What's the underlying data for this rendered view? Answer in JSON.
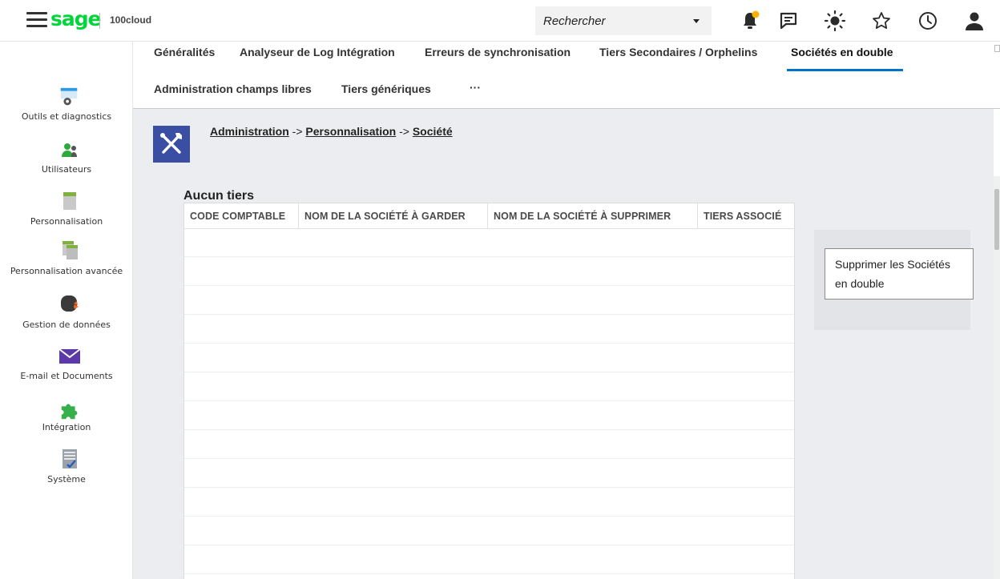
{
  "topbar": {
    "logo": "sage",
    "product": "100cloud",
    "search_placeholder": "Rechercher",
    "notification_dot_color": "#ffb100"
  },
  "sidebar": {
    "items": [
      {
        "label": "Outils et diagnostics",
        "icon": "tools-diagnostics-icon"
      },
      {
        "label": "Utilisateurs",
        "icon": "users-icon"
      },
      {
        "label": "Personnalisation",
        "icon": "customization-icon"
      },
      {
        "label": "Personnalisation avancée",
        "icon": "advanced-customization-icon"
      },
      {
        "label": "Gestion de données",
        "icon": "database-icon"
      },
      {
        "label": "E-mail et Documents",
        "icon": "mail-icon"
      },
      {
        "label": "Intégration",
        "icon": "puzzle-icon"
      },
      {
        "label": "Système",
        "icon": "system-icon"
      }
    ]
  },
  "tabs": {
    "row1": [
      "Généralités",
      "Analyseur de Log Intégration",
      "Erreurs de synchronisation",
      "Tiers Secondaires / Orphelins",
      "Sociétés en double"
    ],
    "row2": [
      "Administration champs libres",
      "Tiers génériques",
      "···"
    ],
    "active": "Sociétés en double"
  },
  "breadcrumb": {
    "items": [
      "Administration",
      "Personnalisation",
      "Société"
    ],
    "separator": "->"
  },
  "main": {
    "section_title": "Aucun tiers",
    "columns": [
      "CODE COMPTABLE",
      "NOM DE LA SOCIÉTÉ À GARDER",
      "NOM DE LA SOCIÉTÉ À SUPPRIMER",
      "TIERS ASSOCIÉ"
    ],
    "action_button": "Supprimer les Sociétés en double"
  },
  "colors": {
    "brand": "#00d639",
    "accent": "#0074c8",
    "page_icon_bg": "#3a4fa3",
    "content_bg": "#ecedf0"
  }
}
